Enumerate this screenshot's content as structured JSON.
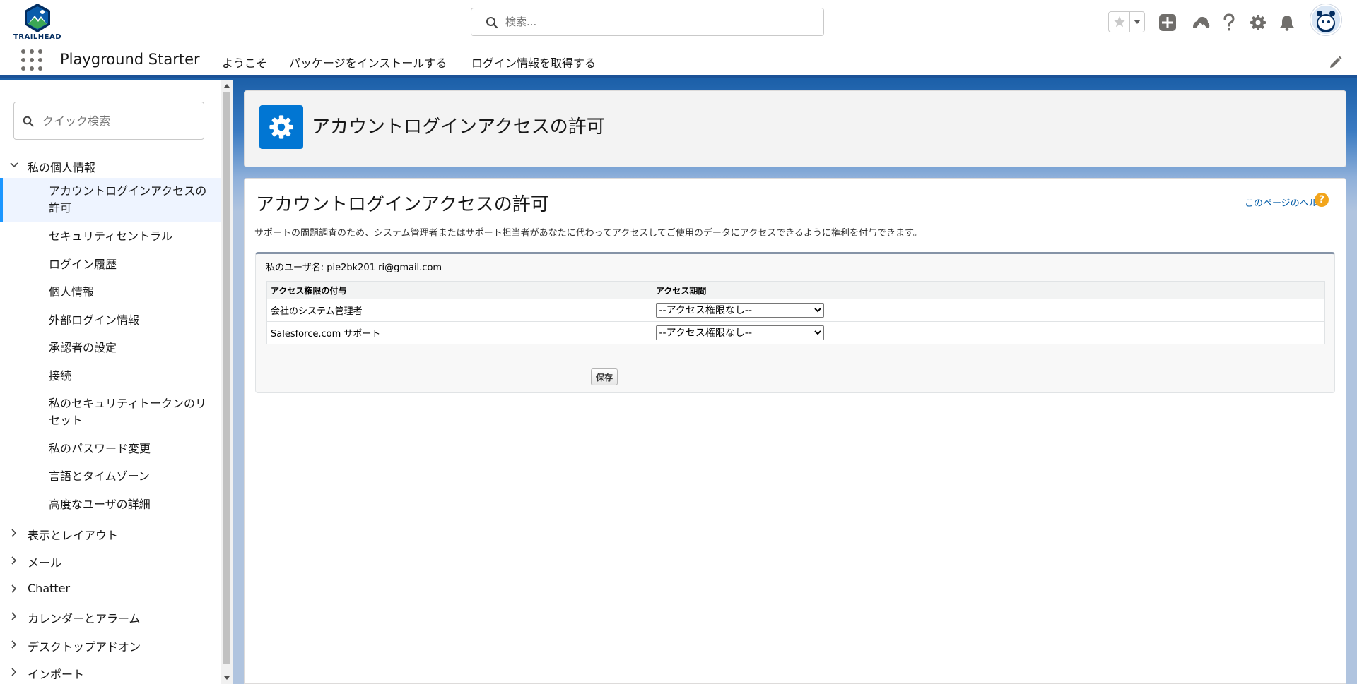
{
  "header": {
    "logo_text": "TRAILHEAD",
    "search_placeholder": "検索..."
  },
  "app_nav": {
    "app_name": "Playground Starter",
    "items": [
      "ようこそ",
      "パッケージをインストールする",
      "ログイン情報を取得する"
    ]
  },
  "sidebar": {
    "quickfind_placeholder": "クイック検索",
    "sections": [
      {
        "label": "私の個人情報",
        "expanded": true,
        "items": [
          "アカウントログインアクセスの許可",
          "セキュリティセントラル",
          "ログイン履歴",
          "個人情報",
          "外部ログイン情報",
          "承認者の設定",
          "接続",
          "私のセキュリティトークンのリセット",
          "私のパスワード変更",
          "言語とタイムゾーン",
          "高度なユーザの詳細"
        ],
        "active_item": "アカウントログインアクセスの許可"
      },
      {
        "label": "表示とレイアウト",
        "expanded": false
      },
      {
        "label": "メール",
        "expanded": false
      },
      {
        "label": "Chatter",
        "expanded": false
      },
      {
        "label": "カレンダーとアラーム",
        "expanded": false
      },
      {
        "label": "デスクトップアドオン",
        "expanded": false
      },
      {
        "label": "インポート",
        "expanded": false
      }
    ]
  },
  "page_header": {
    "title": "アカウントログインアクセスの許可",
    "icon": "gear-icon"
  },
  "content": {
    "title": "アカウントログインアクセスの許可",
    "help_link": "このページのヘルプ",
    "help_icon": "?",
    "description": "サポートの問題調査のため、システム管理者またはサポート担当者があなたに代わってアクセスしてご使用のデータにアクセスできるように権利を付与できます。",
    "username_label": "私のユーザ名: pie2bk201 ri@gmail.com",
    "table": {
      "headers": [
        "アクセス権限の付与",
        "アクセス期間"
      ],
      "rows": [
        {
          "grantee": "会社のシステム管理者",
          "duration": "--アクセス権限なし--"
        },
        {
          "grantee": "Salesforce.com サポート",
          "duration": "--アクセス権限なし--"
        }
      ]
    },
    "save_label": "保存"
  },
  "colors": {
    "brand_blue": "#0176d3",
    "nav_border": "#1b5297",
    "help_orange": "#f2a51c",
    "active_item_bg": "#eef4ff",
    "active_item_border": "#1b96ff"
  }
}
